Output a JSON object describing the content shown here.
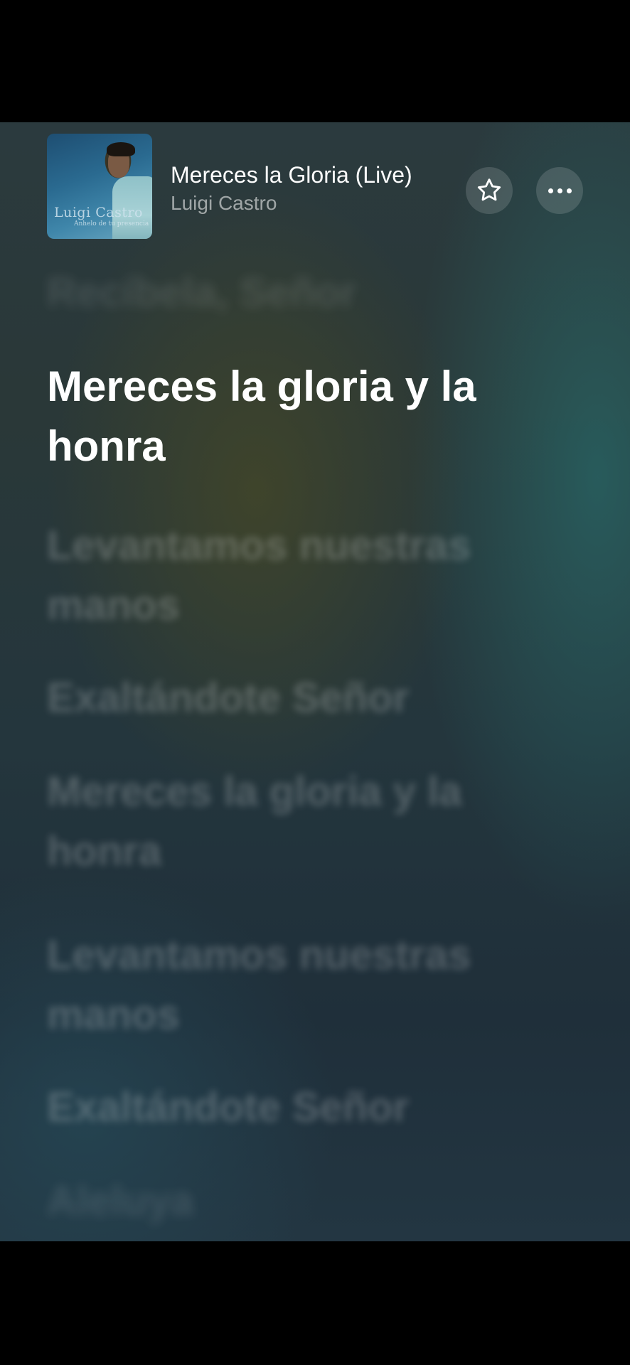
{
  "now_playing": {
    "title": "Mereces la Gloria (Live)",
    "artist": "Luigi Castro",
    "album_art_text": "Luigi Castro",
    "album_art_subtext": "Anhelo de tu presencia"
  },
  "controls": {
    "favorite_icon": "star-icon",
    "more_icon": "ellipsis-icon"
  },
  "lyrics": [
    "Recíbela, Señor",
    "Mereces la gloria y la honra",
    "Levantamos nuestras manos",
    "Exaltándote Señor",
    "Mereces la gloria y la honra",
    "Levantamos nuestras manos",
    "Exaltándote Señor",
    "Aleluya"
  ],
  "current_lyric_index": 1,
  "colors": {
    "background_top": "#2b3a3e",
    "background_bottom": "#233642",
    "active_lyric": "#ffffff"
  }
}
